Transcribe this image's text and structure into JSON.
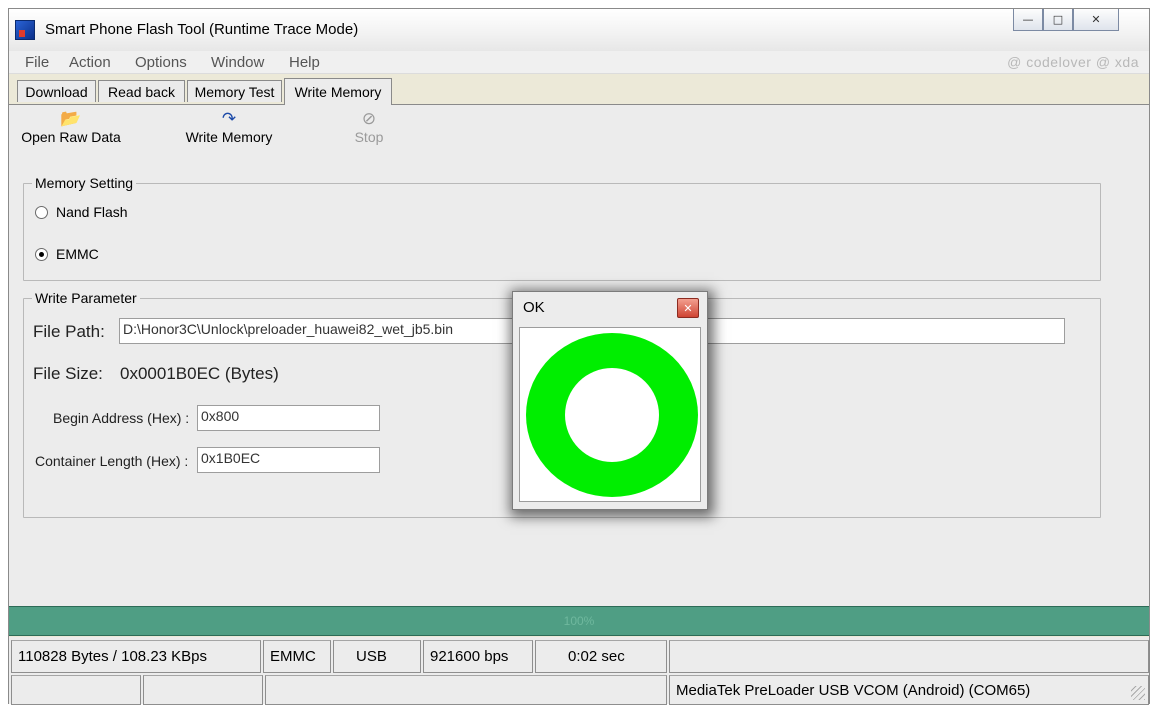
{
  "window": {
    "title": "Smart Phone Flash Tool (Runtime Trace Mode)"
  },
  "menu": [
    "File",
    "Action",
    "Options",
    "Window",
    "Help"
  ],
  "watermark": "@ codelover @ xda",
  "tabs": [
    "Download",
    "Read back",
    "Memory Test",
    "Write Memory"
  ],
  "toolbar": {
    "open_label": "Open Raw Data",
    "write_label": "Write Memory",
    "stop_label": "Stop",
    "open_icon": "folder-open-icon",
    "write_icon": "write-arrow-icon",
    "stop_icon": "stop-icon"
  },
  "memory_setting": {
    "legend": "Memory Setting",
    "options": [
      "Nand Flash",
      "EMMC"
    ],
    "selected": "EMMC"
  },
  "write_parameter": {
    "legend": "Write Parameter",
    "file_path_label": "File Path:",
    "file_path_value": "D:\\Honor3C\\Unlock\\preloader_huawei82_wet_jb5.bin",
    "file_size_label": "File Size:",
    "file_size_value": "0x0001B0EC (Bytes)",
    "begin_label": "Begin Address (Hex) :",
    "begin_value": "0x800",
    "length_label": "Container Length (Hex) :",
    "length_value": "0x1B0EC"
  },
  "progress": {
    "value": 1.0,
    "text": "100%",
    "color": "#4f9e84"
  },
  "status": {
    "bytes": "110828 Bytes / 108.23 KBps",
    "storage": "EMMC",
    "conn": "USB",
    "baud": "921600 bps",
    "time": "0:02 sec",
    "port": "MediaTek PreLoader USB VCOM (Android) (COM65)"
  },
  "dialog": {
    "title": "OK",
    "ring_color": "#00ee00"
  }
}
